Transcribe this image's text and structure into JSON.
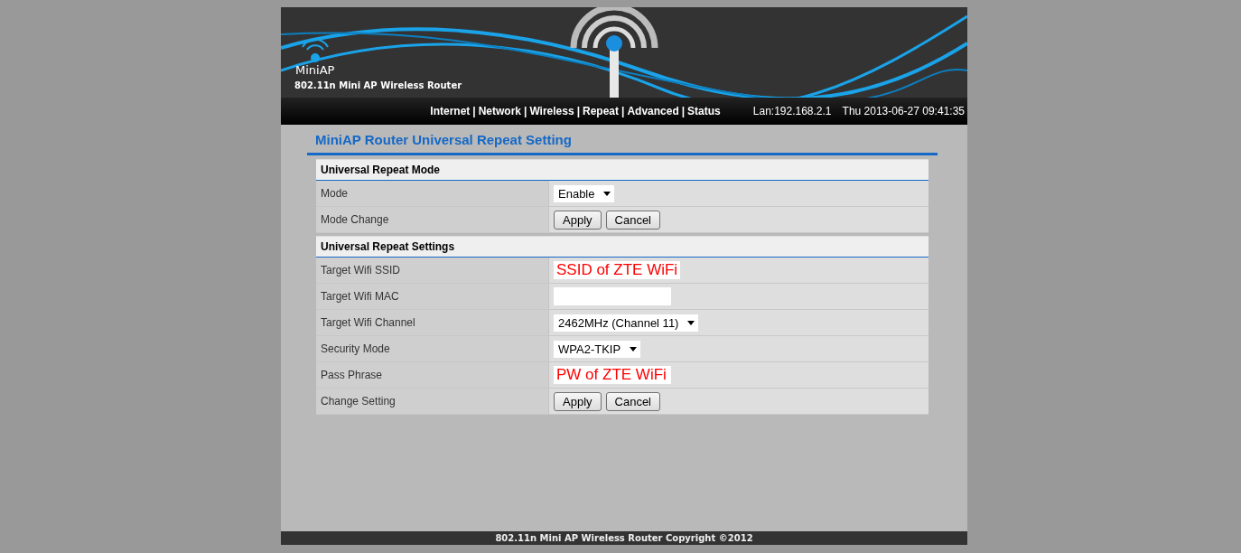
{
  "header": {
    "brand": "MiniAP",
    "subtitle": "802.11n Mini AP Wireless Router"
  },
  "nav": {
    "links": [
      "Internet",
      "Network",
      "Wireless",
      "Repeat",
      "Advanced",
      "Status"
    ],
    "separator": "|",
    "lan": "Lan:192.168.2.1",
    "datetime": "Thu 2013-06-27 09:41:35"
  },
  "page_title": "MiniAP Router Universal Repeat Setting",
  "sections": [
    {
      "title": "Universal Repeat Mode",
      "rows": [
        {
          "label": "Mode",
          "kind": "select",
          "value": "Enable"
        },
        {
          "label": "Mode Change",
          "kind": "buttons",
          "buttons": [
            "Apply",
            "Cancel"
          ]
        }
      ]
    },
    {
      "title": "Universal Repeat Settings",
      "rows": [
        {
          "label": "Target Wifi SSID",
          "kind": "input",
          "value": "SSID of ZTE WiFi"
        },
        {
          "label": "Target Wifi MAC",
          "kind": "input"
        },
        {
          "label": "Target Wifi Channel",
          "kind": "select",
          "value": "2462MHz (Channel 11)"
        },
        {
          "label": "Security Mode",
          "kind": "select",
          "value": "WPA2-TKIP"
        },
        {
          "label": "Pass Phrase",
          "kind": "input",
          "value": "PW of ZTE WiFi"
        },
        {
          "label": "Change Setting",
          "kind": "buttons",
          "buttons": [
            "Apply",
            "Cancel"
          ]
        }
      ]
    }
  ],
  "footer": "802.11n Mini AP Wireless Router Copyright ©2012"
}
